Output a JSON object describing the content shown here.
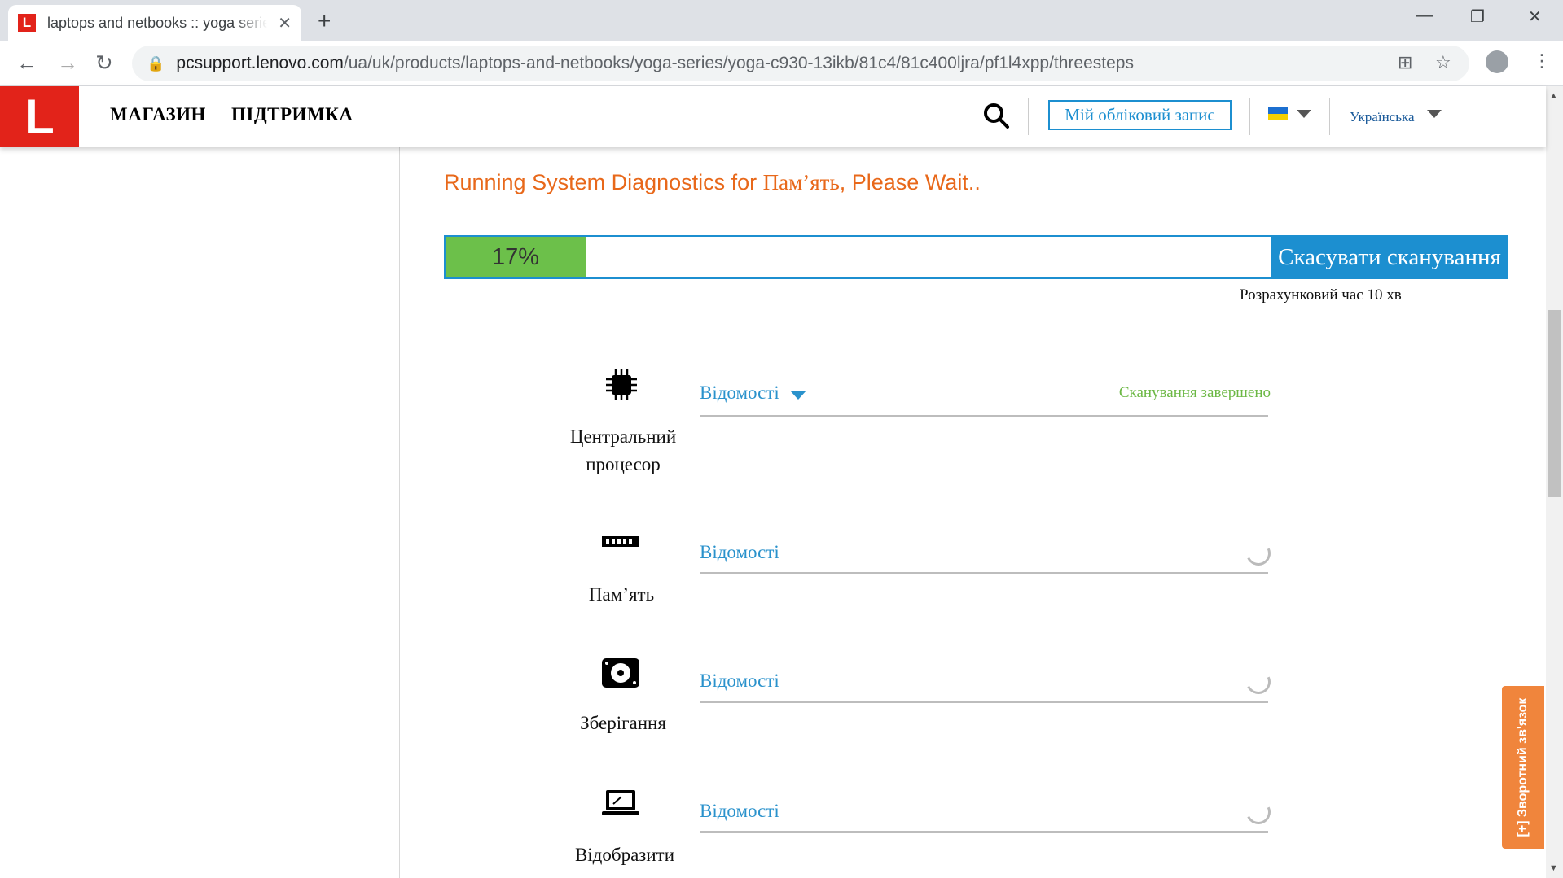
{
  "browser": {
    "tab_title": "laptops and netbooks :: yoga series",
    "new_tab": "+",
    "url_host": "pcsupport.lenovo.com",
    "url_path": "/ua/uk/products/laptops-and-netbooks/yoga-series/yoga-c930-13ikb/81c4/81c400ljra/pf1l4xpp/threesteps"
  },
  "header": {
    "logo": "L",
    "nav": [
      "МАГАЗИН",
      "ПІДТРИМКА"
    ],
    "account_label": "Мій обліковий запис",
    "language": "Українська"
  },
  "diagnostics": {
    "title_prefix": "Running System Diagnostics for ",
    "title_component": "Пам’ять",
    "title_suffix": ", Please Wait..",
    "progress_percent": 17,
    "progress_label": "17%",
    "cancel_label": "Скасувати сканування",
    "estimate_label": "Розрахунковий час 10 хв"
  },
  "tests": [
    {
      "name": "Центральний процесор",
      "details": "Відомості",
      "status": "Сканування завершено",
      "done": true
    },
    {
      "name": "Пам’ять",
      "details": "Відомості",
      "status": "",
      "done": false
    },
    {
      "name": "Зберігання",
      "details": "Відомості",
      "status": "",
      "done": false
    },
    {
      "name": "Відобразити",
      "details": "Відомості",
      "status": "",
      "done": false
    }
  ],
  "feedback_label": "[+] Зворотний зв'язок",
  "colors": {
    "brand_red": "#e2231a",
    "accent_blue": "#1c8fd0",
    "progress_green": "#6cc04a",
    "title_orange": "#e8681a",
    "feedback_orange": "#f0853c"
  }
}
